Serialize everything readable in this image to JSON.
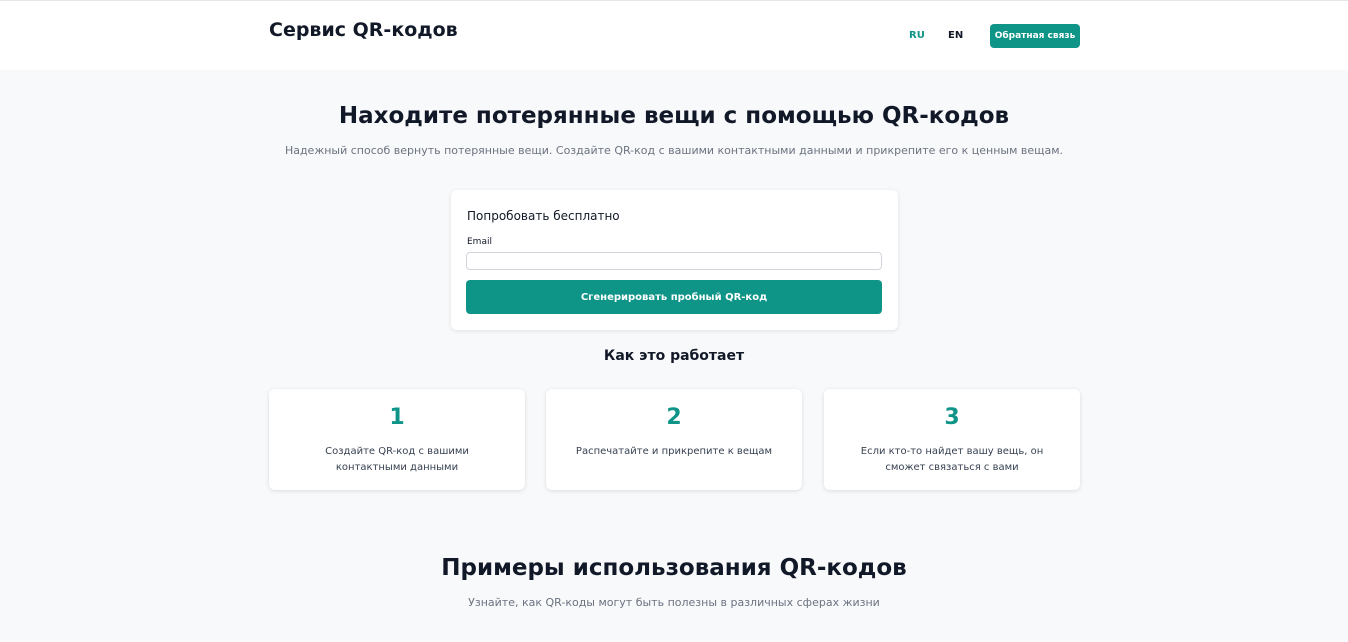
{
  "header": {
    "brand": "Сервис QR-кодов",
    "languages": [
      {
        "code": "RU",
        "active": true
      },
      {
        "code": "EN",
        "active": false
      }
    ],
    "feedback_label": "Обратная связь"
  },
  "hero": {
    "title": "Находите потерянные вещи с помощью QR-кодов",
    "subtitle": "Надежный способ вернуть потерянные вещи. Создайте QR-код с вашими контактными данными и прикрепите его к ценным вещам."
  },
  "trial_form": {
    "title": "Попробовать бесплатно",
    "email_label": "Email",
    "email_value": "",
    "email_placeholder": "",
    "submit_label": "Сгенерировать пробный QR-код"
  },
  "how_it_works": {
    "title": "Как это работает",
    "steps": [
      {
        "number": "1",
        "text": "Создайте QR-код с вашими контактными данными"
      },
      {
        "number": "2",
        "text": "Распечатайте и прикрепите к вещам"
      },
      {
        "number": "3",
        "text": "Если кто-то найдет вашу вещь, он сможет связаться с вами"
      }
    ]
  },
  "examples": {
    "title": "Примеры использования QR-кодов",
    "subtitle": "Узнайте, как QR-коды могут быть полезны в различных сферах жизни"
  },
  "colors": {
    "accent": "#0f9488",
    "background": "#f8f9fb",
    "text": "#111827",
    "muted": "#6b7280"
  }
}
